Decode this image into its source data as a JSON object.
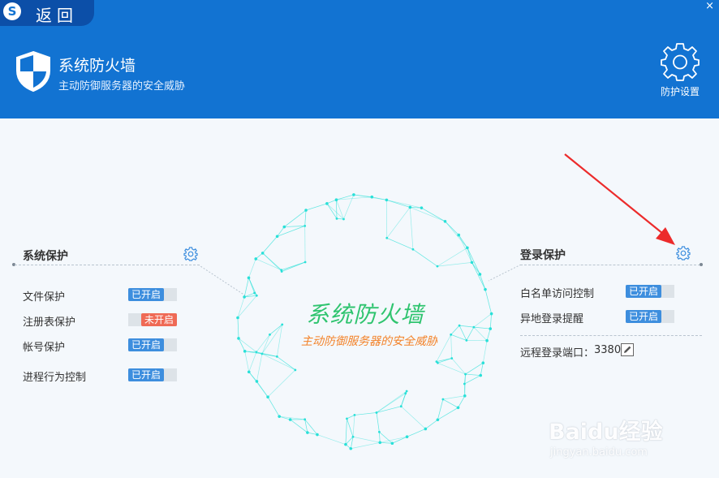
{
  "header": {
    "logo_letter": "S",
    "back_label": "返回",
    "close_symbol": "×",
    "title": "系统防火墙",
    "subtitle": "主动防御服务器的安全威胁",
    "settings_label": "防护设置"
  },
  "system_protection": {
    "title": "系统保护",
    "items": [
      {
        "label": "文件保护",
        "status": "已开启",
        "enabled": true
      },
      {
        "label": "注册表保护",
        "status": "未开启",
        "enabled": false
      },
      {
        "label": "帐号保护",
        "status": "已开启",
        "enabled": true
      },
      {
        "label": "进程行为控制",
        "status": "已开启",
        "enabled": true
      }
    ]
  },
  "login_protection": {
    "title": "登录保护",
    "items": [
      {
        "label": "白名单访问控制",
        "status": "已开启",
        "enabled": true
      },
      {
        "label": "异地登录提醒",
        "status": "已开启",
        "enabled": true
      }
    ],
    "port_label": "远程登录端口：",
    "port_value": "3380"
  },
  "center": {
    "title": "系统防火墙",
    "subtitle": "主动防御服务器的安全威胁"
  },
  "watermark": {
    "brand": "Baidu经验",
    "url": "jingyan.baidu.com"
  },
  "colors": {
    "header_blue": "#1273d2",
    "on_blue": "#3d8ede",
    "off_red": "#ef6a55",
    "center_green": "#2fc46f",
    "center_orange": "#f3832a",
    "globe_cyan": "#29e0d8"
  }
}
